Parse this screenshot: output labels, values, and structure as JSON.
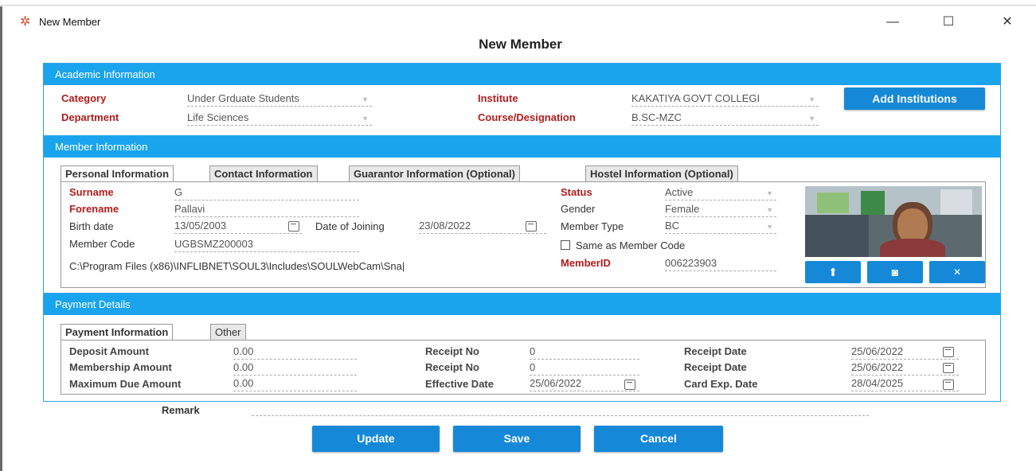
{
  "window": {
    "title": "New Member",
    "heading": "New Member",
    "minimize_glyph": "—",
    "maximize_glyph": "☐",
    "close_glyph": "✕"
  },
  "academic": {
    "header": "Academic Information",
    "category_label": "Category",
    "category_value": "Under Grduate Students",
    "institute_label": "Institute",
    "institute_value": "KAKATIYA GOVT COLLEGI",
    "add_institutions_label": "Add Institutions",
    "department_label": "Department",
    "department_value": "Life Sciences",
    "course_label": "Course/Designation",
    "course_value": "B.SC-MZC"
  },
  "member": {
    "header": "Member Information",
    "tabs": [
      {
        "label": "Personal Information",
        "active": true
      },
      {
        "label": "Contact Information",
        "active": false
      },
      {
        "label": "Guarantor Information (Optional)",
        "active": false
      },
      {
        "label": "Hostel Information (Optional)",
        "active": false
      }
    ],
    "surname_label": "Surname",
    "surname_value": "G",
    "forename_label": "Forename",
    "forename_value": "Pallavi",
    "birth_label": "Birth date",
    "birth_value": "13/05/2003",
    "doj_label": "Date of Joining",
    "doj_value": "23/08/2022",
    "code_label": "Member Code",
    "code_value": "UGBSMZ200003",
    "photo_path": "C:\\Program Files (x86)\\INFLIBNET\\SOUL3\\Includes\\SOULWebCam\\Sna|",
    "status_label": "Status",
    "status_value": "Active",
    "gender_label": "Gender",
    "gender_value": "Female",
    "type_label": "Member Type",
    "type_value": "BC",
    "same_as_label": "Same as Member Code",
    "memberid_label": "MemberID",
    "memberid_value": "006223903"
  },
  "payment": {
    "header": "Payment Details",
    "tabs": [
      {
        "label": "Payment Information",
        "active": true
      },
      {
        "label": "Other",
        "active": false
      }
    ],
    "deposit_label": "Deposit Amount",
    "deposit_value": "0.00",
    "membership_label": "Membership Amount",
    "membership_value": "0.00",
    "maxdue_label": "Maximum Due Amount",
    "maxdue_value": "0.00",
    "receipt_no_label_1": "Receipt No",
    "receipt_no_value_1": "0",
    "receipt_no_label_2": "Receipt No",
    "receipt_no_value_2": "0",
    "effective_label": "Effective Date",
    "effective_value": "25/06/2022",
    "receipt_date_label_1": "Receipt Date",
    "receipt_date_value_1": "25/06/2022",
    "receipt_date_label_2": "Receipt Date",
    "receipt_date_value_2": "25/06/2022",
    "card_exp_label": "Card Exp. Date",
    "card_exp_value": "28/04/2025"
  },
  "remark_label": "Remark",
  "buttons": {
    "update": "Update",
    "save": "Save",
    "cancel": "Cancel"
  },
  "colors": {
    "accent": "#1ba4ee",
    "button": "#1589d8",
    "required_label": "#b31b1b"
  }
}
